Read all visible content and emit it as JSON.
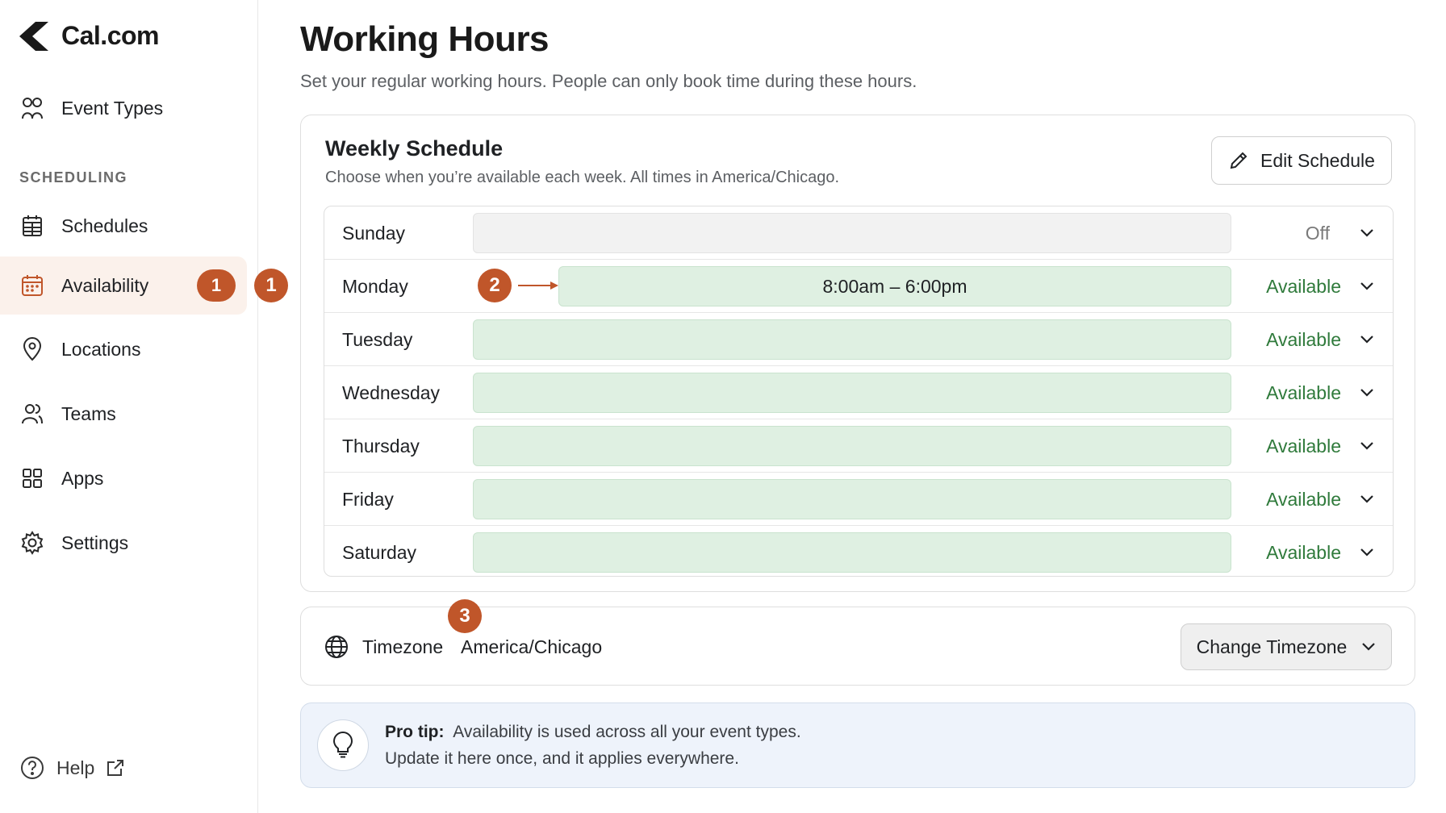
{
  "brand": {
    "name": "Cal.com"
  },
  "sidebar": {
    "section_label": "SCHEDULING",
    "items": [
      {
        "label": "Event Types",
        "icon": "users-icon"
      },
      {
        "label": "Schedules",
        "icon": "schedule-icon"
      },
      {
        "label": "Availability",
        "icon": "calendar-icon",
        "badge": "1",
        "active": true
      },
      {
        "label": "Locations",
        "icon": "map-pin-icon"
      },
      {
        "label": "Teams",
        "icon": "team-icon"
      },
      {
        "label": "Apps",
        "icon": "grid-icon"
      },
      {
        "label": "Settings",
        "icon": "gear-icon"
      }
    ],
    "help_label": "Help"
  },
  "markers": {
    "m1": "1",
    "m2": "2",
    "m3": "3"
  },
  "page": {
    "title": "Working Hours",
    "subtitle": "Set your regular working hours. People can only book time during these hours."
  },
  "weekly": {
    "title": "Weekly Schedule",
    "subtitle": "Choose when you’re available each week. All times in America/Chicago.",
    "edit_label": "Edit Schedule",
    "days": [
      {
        "day": "Sunday",
        "status": "Off",
        "hours": ""
      },
      {
        "day": "Monday",
        "status": "Available",
        "hours": "8:00am – 6:00pm"
      },
      {
        "day": "Tuesday",
        "status": "Available",
        "hours": ""
      },
      {
        "day": "Wednesday",
        "status": "Available",
        "hours": ""
      },
      {
        "day": "Thursday",
        "status": "Available",
        "hours": ""
      },
      {
        "day": "Friday",
        "status": "Available",
        "hours": ""
      },
      {
        "day": "Saturday",
        "status": "Available",
        "hours": ""
      }
    ]
  },
  "timezone": {
    "label": "Timezone",
    "value": "America/Chicago",
    "button_label": "Change Timezone"
  },
  "tip": {
    "lead": "Pro tip:",
    "line1": "Availability is used across all your event types.",
    "line2": "Update it here once, and it applies everywhere."
  },
  "colors": {
    "accent": "#c0562a",
    "available_text": "#2f7a3b",
    "available_bar": "#dff0e2",
    "off_bar": "#f2f2f2",
    "active_nav_bg": "#fbf1eb",
    "tip_bg": "#eef3fb"
  }
}
